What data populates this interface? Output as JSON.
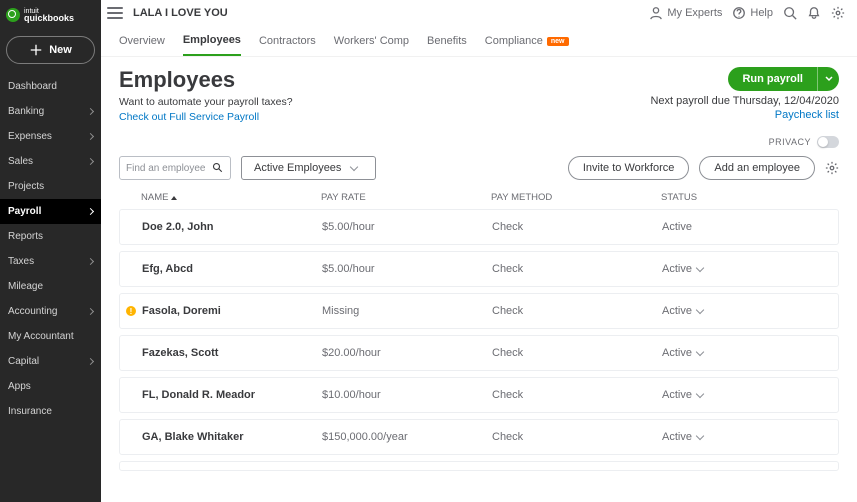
{
  "brand": {
    "top": "intuit",
    "name": "quickbooks"
  },
  "new_btn": "New",
  "sidebar": {
    "items": [
      {
        "label": "Dashboard",
        "chev": false
      },
      {
        "label": "Banking",
        "chev": true
      },
      {
        "label": "Expenses",
        "chev": true
      },
      {
        "label": "Sales",
        "chev": true
      },
      {
        "label": "Projects",
        "chev": false
      },
      {
        "label": "Payroll",
        "chev": true,
        "active": true
      },
      {
        "label": "Reports",
        "chev": false
      },
      {
        "label": "Taxes",
        "chev": true
      },
      {
        "label": "Mileage",
        "chev": false
      },
      {
        "label": "Accounting",
        "chev": true
      },
      {
        "label": "My Accountant",
        "chev": false
      },
      {
        "label": "Capital",
        "chev": true
      },
      {
        "label": "Apps",
        "chev": false
      },
      {
        "label": "Insurance",
        "chev": false
      }
    ]
  },
  "topbar": {
    "company": "LALA I LOVE YOU",
    "my_experts": "My Experts",
    "help": "Help"
  },
  "tabs": [
    {
      "label": "Overview"
    },
    {
      "label": "Employees",
      "active": true
    },
    {
      "label": "Contractors"
    },
    {
      "label": "Workers' Comp"
    },
    {
      "label": "Benefits"
    },
    {
      "label": "Compliance",
      "badge": "new"
    }
  ],
  "page": {
    "title": "Employees",
    "run_payroll": "Run payroll",
    "promo_q": "Want to automate your payroll taxes?",
    "promo_link": "Check out Full Service Payroll",
    "next_payroll": "Next payroll due Thursday, 12/04/2020",
    "paycheck_list": "Paycheck list",
    "privacy": "PRIVACY",
    "search_placeholder": "Find an employee",
    "filter": "Active Employees",
    "invite_btn": "Invite to Workforce",
    "add_btn": "Add an employee"
  },
  "columns": {
    "name": "NAME",
    "rate": "PAY RATE",
    "method": "PAY METHOD",
    "status": "STATUS"
  },
  "rows": [
    {
      "name": "Doe 2.0, John",
      "rate": "$5.00/hour",
      "method": "Check",
      "status": "Active",
      "drop": false
    },
    {
      "name": "Efg, Abcd",
      "rate": "$5.00/hour",
      "method": "Check",
      "status": "Active",
      "drop": true
    },
    {
      "name": "Fasola, Doremi",
      "rate": "Missing",
      "method": "Check",
      "status": "Active",
      "drop": true,
      "warn": true
    },
    {
      "name": "Fazekas, Scott",
      "rate": "$20.00/hour",
      "method": "Check",
      "status": "Active",
      "drop": true
    },
    {
      "name": "FL, Donald R. Meador",
      "rate": "$10.00/hour",
      "method": "Check",
      "status": "Active",
      "drop": true
    },
    {
      "name": "GA, Blake Whitaker",
      "rate": "$150,000.00/year",
      "method": "Check",
      "status": "Active",
      "drop": true
    }
  ]
}
